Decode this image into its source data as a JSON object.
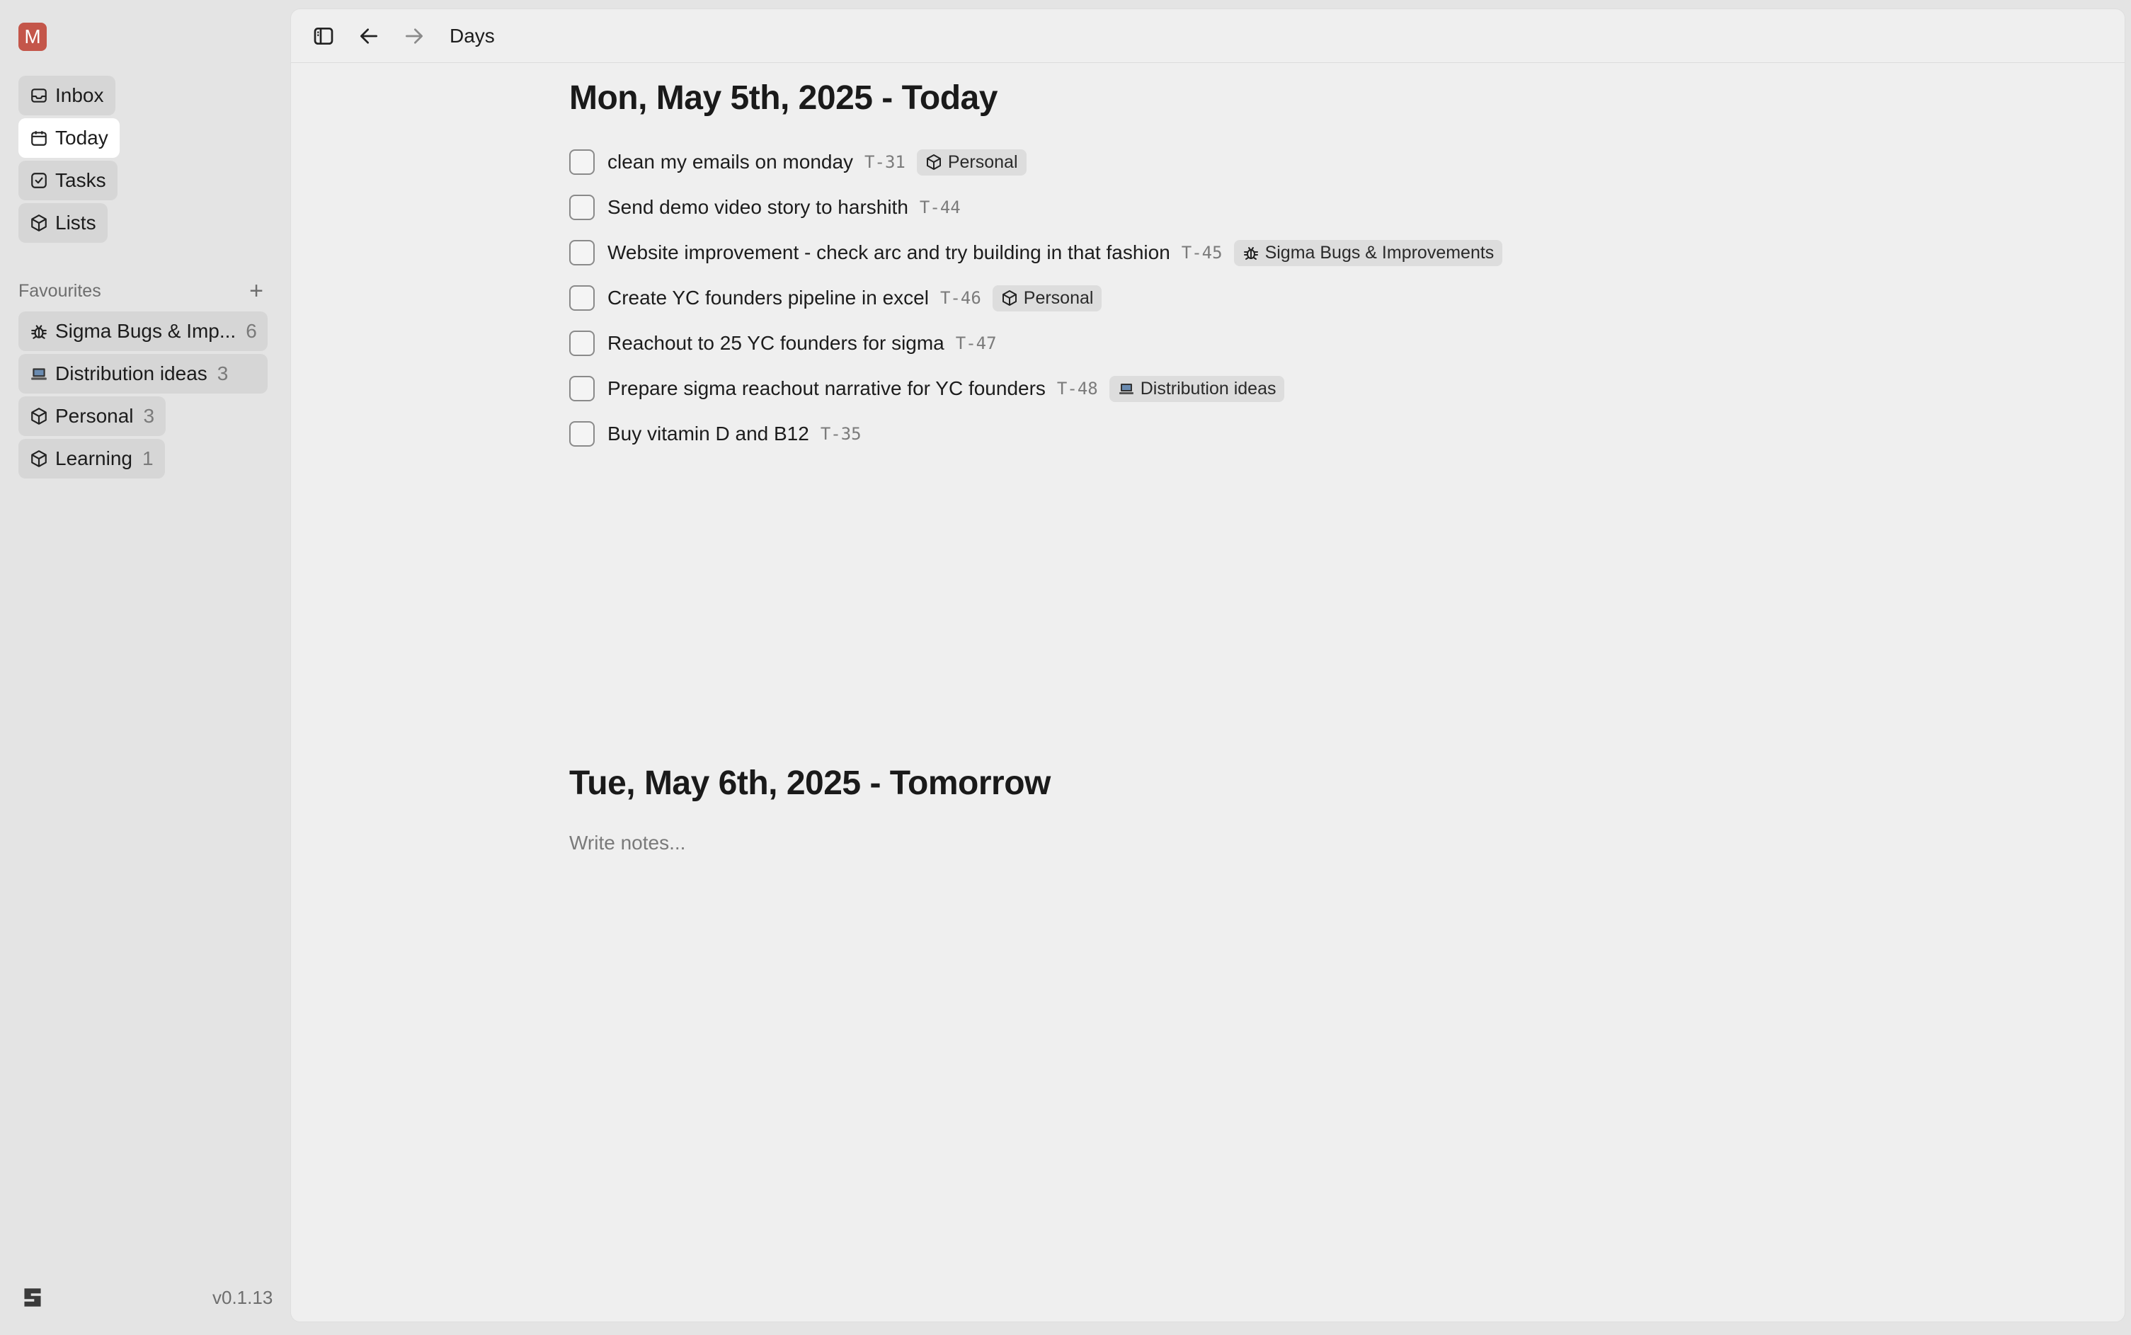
{
  "sidebar": {
    "avatar_letter": "M",
    "nav": [
      {
        "label": "Inbox",
        "icon": "inbox-icon"
      },
      {
        "label": "Today",
        "icon": "calendar-icon"
      },
      {
        "label": "Tasks",
        "icon": "check-square-icon"
      },
      {
        "label": "Lists",
        "icon": "box-icon"
      }
    ],
    "favourites_label": "Favourites",
    "favourites_add": "+",
    "favourites": [
      {
        "label": "Sigma Bugs & Imp...",
        "count": "6",
        "icon": "bug-icon"
      },
      {
        "label": "Distribution ideas",
        "count": "3",
        "icon": "laptop-icon"
      },
      {
        "label": "Personal",
        "count": "3",
        "icon": "box-icon"
      },
      {
        "label": "Learning",
        "count": "1",
        "icon": "box-icon"
      }
    ],
    "version": "v0.1.13"
  },
  "topbar": {
    "title": "Days"
  },
  "days": [
    {
      "title": "Mon, May 5th, 2025 - Today",
      "tasks": [
        {
          "text": "clean my emails on monday",
          "id": "T-31",
          "tag": "Personal",
          "tag_icon": "box-icon"
        },
        {
          "text": "Send demo video story to harshith",
          "id": "T-44"
        },
        {
          "text": "Website improvement - check arc and try building in that fashion",
          "id": "T-45",
          "tag": "Sigma Bugs & Improvements",
          "tag_icon": "bug-icon"
        },
        {
          "text": "Create YC founders pipeline in excel",
          "id": "T-46",
          "tag": "Personal",
          "tag_icon": "box-icon"
        },
        {
          "text": "Reachout to 25 YC founders for sigma",
          "id": "T-47"
        },
        {
          "text": "Prepare sigma reachout narrative for YC founders",
          "id": "T-48",
          "tag": "Distribution ideas",
          "tag_icon": "laptop-icon"
        },
        {
          "text": "Buy vitamin D and B12",
          "id": "T-35"
        }
      ]
    },
    {
      "title": "Tue, May 6th, 2025 - Tomorrow",
      "notes_placeholder": "Write notes..."
    }
  ]
}
